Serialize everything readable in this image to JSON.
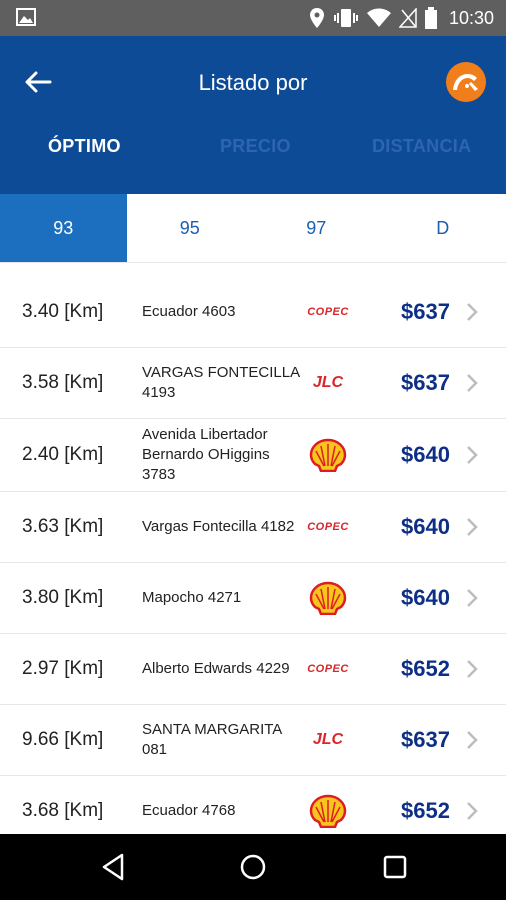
{
  "status": {
    "time": "10:30"
  },
  "header": {
    "title": "Listado por"
  },
  "tabs": [
    "ÓPTIMO",
    "PRECIO",
    "DISTANCIA"
  ],
  "fuel_types": [
    "93",
    "95",
    "97",
    "D"
  ],
  "stations": [
    {
      "distance": "3.40 [Km]",
      "address": "Ecuador 4603",
      "brand": "COPEC",
      "price": "$637"
    },
    {
      "distance": "3.58 [Km]",
      "address": "VARGAS FONTECILLA 4193",
      "brand": "JLC",
      "price": "$637"
    },
    {
      "distance": "2.40 [Km]",
      "address": "Avenida Libertador Bernardo OHiggins 3783",
      "brand": "shell",
      "price": "$640"
    },
    {
      "distance": "3.63 [Km]",
      "address": "Vargas Fontecilla 4182",
      "brand": "COPEC",
      "price": "$640"
    },
    {
      "distance": "3.80 [Km]",
      "address": "Mapocho 4271",
      "brand": "shell",
      "price": "$640"
    },
    {
      "distance": "2.97 [Km]",
      "address": "Alberto Edwards 4229",
      "brand": "COPEC",
      "price": "$652"
    },
    {
      "distance": "9.66 [Km]",
      "address": "SANTA MARGARITA 081",
      "brand": "JLC",
      "price": "$637"
    },
    {
      "distance": "3.68 [Km]",
      "address": "Ecuador 4768",
      "brand": "shell",
      "price": "$652"
    }
  ],
  "colors": {
    "primary": "#0e4b97",
    "selected_fuel": "#1c6fbe",
    "price": "#0e2f86",
    "accent": "#f07f1b"
  }
}
